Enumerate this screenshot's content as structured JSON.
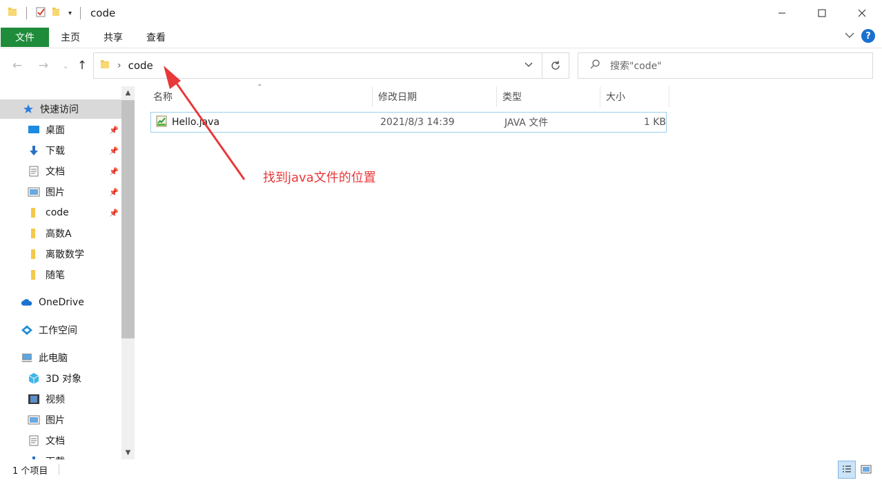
{
  "window": {
    "title": "code"
  },
  "ribbon": {
    "tabs": [
      "文件",
      "主页",
      "共享",
      "查看"
    ]
  },
  "address": {
    "crumb": "code",
    "search_placeholder": "搜索\"code\""
  },
  "sidebar": {
    "quick_access": "快速访问",
    "quick_items": [
      "桌面",
      "下载",
      "文档",
      "图片",
      "code",
      "高数A",
      "离散数学",
      "随笔"
    ],
    "onedrive": "OneDrive",
    "workspace": "工作空间",
    "this_pc": "此电脑",
    "pc_items": [
      "3D 对象",
      "视频",
      "图片",
      "文档",
      "下载"
    ]
  },
  "list": {
    "columns": [
      "名称",
      "修改日期",
      "类型",
      "大小"
    ],
    "rows": [
      {
        "name": "Hello.java",
        "date": "2021/8/3 14:39",
        "type": "JAVA 文件",
        "size": "1 KB"
      }
    ]
  },
  "annotation": {
    "text": "找到java文件的位置",
    "color": "#e8383a"
  },
  "status": {
    "count": "1 个项目"
  },
  "colors": {
    "file_tab": "#1e8c3a",
    "selection_border": "#9bd0ee",
    "help": "#1a6fd1"
  }
}
